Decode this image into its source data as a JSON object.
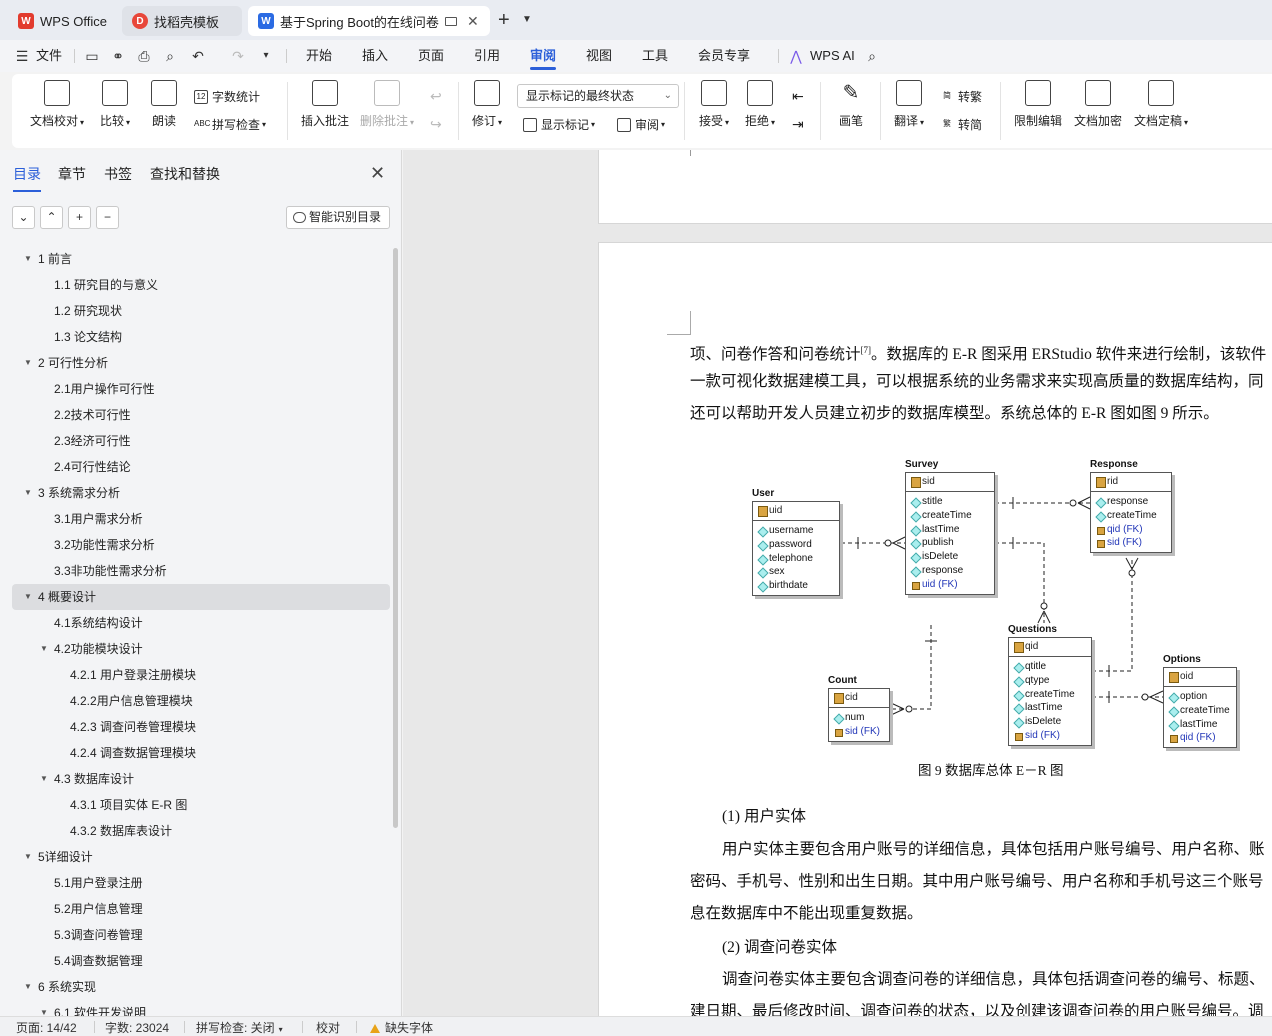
{
  "tabs": [
    {
      "label": "WPS Office",
      "icon": "wps-logo-icon",
      "active": false
    },
    {
      "label": "找稻壳模板",
      "icon": "docer-icon",
      "active": false
    },
    {
      "label": "基于Spring Boot的在线问卷",
      "icon": "writer-doc-icon",
      "active": true
    }
  ],
  "menu": {
    "file": "文件",
    "items": [
      "开始",
      "插入",
      "页面",
      "引用",
      "审阅",
      "视图",
      "工具",
      "会员专享"
    ],
    "active": "审阅",
    "ai": "WPS AI"
  },
  "ribbon": {
    "doc_check": "文档校对",
    "compare": "比较",
    "read_aloud": "朗读",
    "word_count": "字数统计",
    "spell_check": "拼写检查",
    "insert_comment": "插入批注",
    "delete_comment": "删除批注",
    "revise": "修订",
    "markup_state": "显示标记的最终状态",
    "show_markup": "显示标记",
    "review": "审阅",
    "accept": "接受",
    "reject": "拒绝",
    "pen": "画笔",
    "translate": "翻译",
    "to_traditional": "转繁",
    "to_simplified": "转简",
    "restrict_edit": "限制编辑",
    "encrypt": "文档加密",
    "finalize": "文档定稿"
  },
  "sidebar": {
    "tabs": [
      "目录",
      "章节",
      "书签",
      "查找和替换"
    ],
    "active_tab": "目录",
    "smart_toc": "智能识别目录",
    "toc": [
      {
        "label": "1   前言",
        "level": 1,
        "arrow": true
      },
      {
        "label": "1.1   研究目的与意义",
        "level": 2
      },
      {
        "label": "1.2   研究现状",
        "level": 2
      },
      {
        "label": "1.3   论文结构",
        "level": 2
      },
      {
        "label": "2   可行性分析",
        "level": 1,
        "arrow": true
      },
      {
        "label": "2.1用户操作可行性",
        "level": 2
      },
      {
        "label": "2.2技术可行性",
        "level": 2
      },
      {
        "label": "2.3经济可行性",
        "level": 2
      },
      {
        "label": "2.4可行性结论",
        "level": 2
      },
      {
        "label": "3   系统需求分析",
        "level": 1,
        "arrow": true
      },
      {
        "label": "3.1用户需求分析",
        "level": 2
      },
      {
        "label": "3.2功能性需求分析",
        "level": 2
      },
      {
        "label": "3.3非功能性需求分析",
        "level": 2
      },
      {
        "label": "4   概要设计",
        "level": 1,
        "arrow": true,
        "selected": true
      },
      {
        "label": "4.1系统结构设计",
        "level": 2
      },
      {
        "label": "4.2功能模块设计",
        "level": 2,
        "arrow": true
      },
      {
        "label": "4.2.1  用户登录注册模块",
        "level": 3
      },
      {
        "label": "4.2.2用户信息管理模块",
        "level": 3
      },
      {
        "label": "4.2.3  调查问卷管理模块",
        "level": 3
      },
      {
        "label": "4.2.4  调查数据管理模块",
        "level": 3
      },
      {
        "label": "4.3    数据库设计",
        "level": 2,
        "arrow": true
      },
      {
        "label": "4.3.1    项目实体 E-R 图",
        "level": 3
      },
      {
        "label": "4.3.2    数据库表设计",
        "level": 3
      },
      {
        "label": "5详细设计",
        "level": 1,
        "arrow": true
      },
      {
        "label": "5.1用户登录注册",
        "level": 2
      },
      {
        "label": "5.2用户信息管理",
        "level": 2
      },
      {
        "label": "5.3调查问卷管理",
        "level": 2
      },
      {
        "label": "5.4调查数据管理",
        "level": 2
      },
      {
        "label": "6   系统实现",
        "level": 1,
        "arrow": true
      },
      {
        "label": "6.1   软件开发说明",
        "level": 2,
        "arrow": true
      }
    ]
  },
  "document": {
    "para1_line1": "项、问卷作答和问卷统计",
    "para1_ref": "[7]",
    "para1_line1b": "。数据库的 E-R 图采用 ERStudio 软件来进行绘制，该软件",
    "para1_line2": "一款可视化数据建模工具，可以根据系统的业务需求来实现高质量的数据库结构，同",
    "para1_line3": "还可以帮助开发人员建立初步的数据库模型。系统总体的 E-R 图如图 9 所示。",
    "figure_caption": "图 9  数据库总体 E－R 图",
    "section1_title": "(1)  用户实体",
    "section1_line1": "用户实体主要包含用户账号的详细信息，具体包括用户账号编号、用户名称、账",
    "section1_line2": "密码、手机号、性别和出生日期。其中用户账号编号、用户名称和手机号这三个账号",
    "section1_line3": "息在数据库中不能出现重复数据。",
    "section2_title": "(2)  调查问卷实体",
    "section2_line1": "调查问卷实体主要包含调查问卷的详细信息，具体包括调查问卷的编号、标题、",
    "section2_line2": "建日期、最后修改时间、调查问卷的状态，以及创建该调查问卷的用户账号编号。调"
  },
  "er_diagram": {
    "entities": [
      {
        "name": "User",
        "pk": "uid",
        "fields": [
          "username",
          "password",
          "telephone",
          "sex",
          "birthdate"
        ],
        "fks": []
      },
      {
        "name": "Survey",
        "pk": "sid",
        "fields": [
          "stitle",
          "createTime",
          "lastTime",
          "publish",
          "isDelete",
          "response"
        ],
        "fks": [
          "uid (FK)"
        ]
      },
      {
        "name": "Response",
        "pk": "rid",
        "fields": [
          "response",
          "createTime"
        ],
        "fks": [
          "qid (FK)",
          "sid (FK)"
        ]
      },
      {
        "name": "Questions",
        "pk": "qid",
        "fields": [
          "qtitle",
          "qtype",
          "createTime",
          "lastTime",
          "isDelete"
        ],
        "fks": [
          "sid (FK)"
        ]
      },
      {
        "name": "Count",
        "pk": "cid",
        "fields": [
          "num"
        ],
        "fks": [
          "sid (FK)"
        ]
      },
      {
        "name": "Options",
        "pk": "oid",
        "fields": [
          "option",
          "createTime",
          "lastTime"
        ],
        "fks": [
          "qid (FK)"
        ]
      }
    ]
  },
  "status": {
    "page": "页面: 14/42",
    "words": "字数: 23024",
    "spell": "拼写检查: 关闭",
    "proof": "校对",
    "missing_font": "缺失字体"
  }
}
